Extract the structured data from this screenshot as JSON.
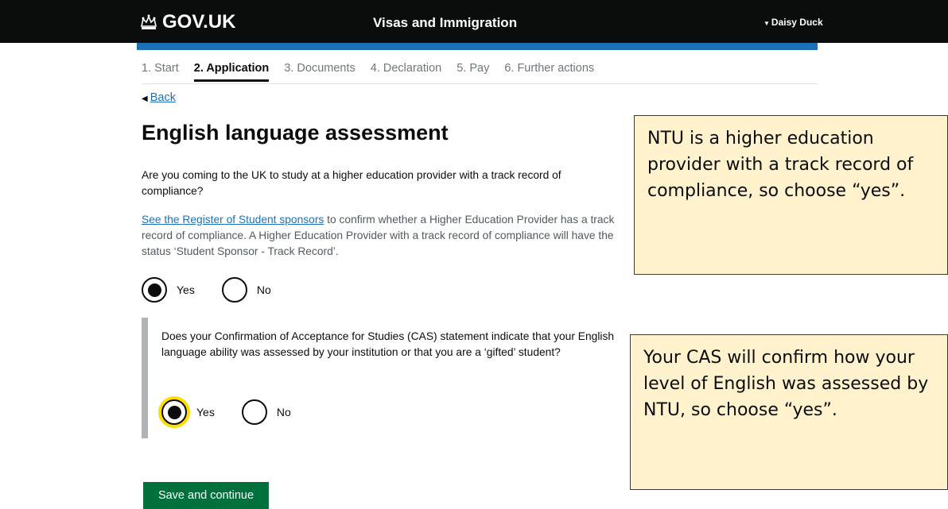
{
  "header": {
    "brand": "GOV.UK",
    "brand_icon": "crown-icon",
    "service_name": "Visas and Immigration",
    "user_name": "Daisy Duck",
    "bg_color": "#0b0c0c",
    "accent_color": "#1d70b8"
  },
  "steps": [
    {
      "label": "1. Start",
      "current": false
    },
    {
      "label": "2. Application",
      "current": true
    },
    {
      "label": "3. Documents",
      "current": false
    },
    {
      "label": "4. Declaration",
      "current": false
    },
    {
      "label": "5. Pay",
      "current": false
    },
    {
      "label": "6. Further actions",
      "current": false
    }
  ],
  "back_link": "Back",
  "page_title": "English language assessment",
  "question1": {
    "text": "Are you coming to the UK to study at a higher education provider with a track record of compliance?",
    "hint_link": "See the Register of Student sponsors",
    "hint_text": " to confirm whether a Higher Education Provider has a track record of compliance. A Higher Education Provider with a track record of compliance will have the status ‘Student Sponsor - Track Record’.",
    "options": [
      {
        "label": "Yes",
        "checked": true
      },
      {
        "label": "No",
        "checked": false
      }
    ]
  },
  "question2": {
    "text": "Does your Confirmation of Acceptance for Studies (CAS) statement indicate that your English language ability was assessed by your institution or that you are a ‘gifted’ student?",
    "options": [
      {
        "label": "Yes",
        "checked": true,
        "focused": true
      },
      {
        "label": "No",
        "checked": false
      }
    ]
  },
  "save_button": "Save and continue",
  "notes": [
    "NTU is a higher education provider with a track record of compliance, so choose “yes”.",
    "Your CAS will confirm how your level of English was assessed by NTU, so choose “yes”."
  ],
  "colors": {
    "link": "#1d70b8",
    "button": "#00703c",
    "focus": "#ffdd00",
    "note_bg": "#fff2cc"
  }
}
